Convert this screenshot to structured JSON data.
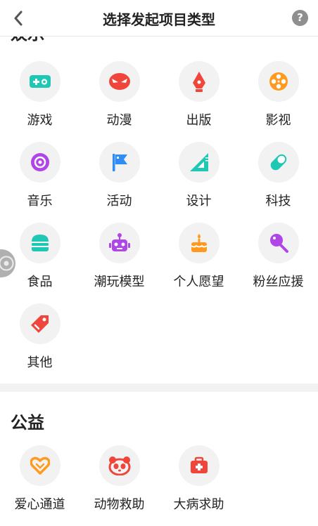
{
  "header": {
    "title": "选择发起项目类型",
    "help": "?"
  },
  "sections": {
    "entertainment": {
      "title": "娱乐",
      "items": [
        {
          "label": "游戏",
          "icon": "gamepad-icon"
        },
        {
          "label": "动漫",
          "icon": "anime-mask-icon"
        },
        {
          "label": "出版",
          "icon": "pen-nib-icon"
        },
        {
          "label": "影视",
          "icon": "film-reel-icon"
        },
        {
          "label": "音乐",
          "icon": "record-icon"
        },
        {
          "label": "活动",
          "icon": "flag-icon"
        },
        {
          "label": "设计",
          "icon": "set-square-icon"
        },
        {
          "label": "科技",
          "icon": "capsule-icon"
        },
        {
          "label": "食品",
          "icon": "burger-icon"
        },
        {
          "label": "潮玩模型",
          "icon": "robot-icon"
        },
        {
          "label": "个人愿望",
          "icon": "cake-icon"
        },
        {
          "label": "粉丝应援",
          "icon": "microphone-icon"
        },
        {
          "label": "其他",
          "icon": "tag-icon"
        }
      ]
    },
    "charity": {
      "title": "公益",
      "items": [
        {
          "label": "爱心通道",
          "icon": "heart-icon"
        },
        {
          "label": "动物救助",
          "icon": "panda-icon"
        },
        {
          "label": "大病求助",
          "icon": "medical-kit-icon"
        }
      ]
    }
  },
  "colors": {
    "teal": "#1fc8b4",
    "red": "#f0453b",
    "orange": "#ff9a1f",
    "purple": "#b046e8",
    "blue": "#2f8df5",
    "divider": "#f2f2f2"
  }
}
